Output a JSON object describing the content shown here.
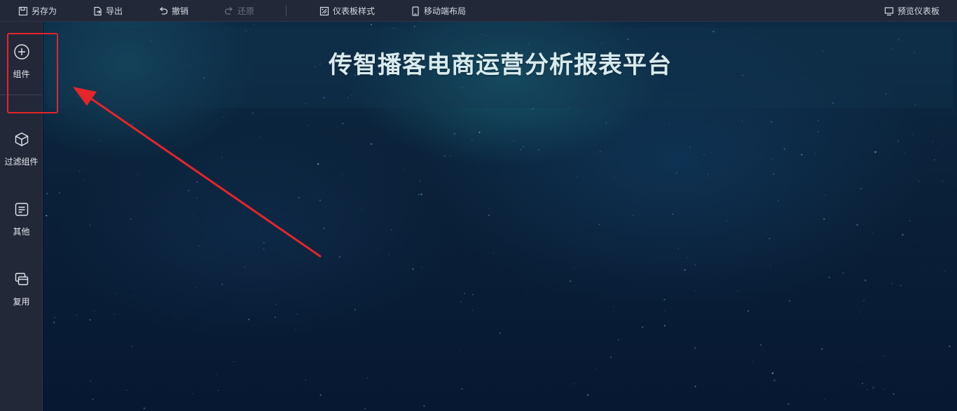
{
  "toolbar": {
    "save_as": "另存为",
    "export": "导出",
    "undo": "撤销",
    "redo": "还原",
    "dashboard_style": "仪表板样式",
    "mobile_layout": "移动端布局",
    "preview": "预览仪表板"
  },
  "sidebar": {
    "items": [
      {
        "label": "组件",
        "icon": "plus-circle-icon"
      },
      {
        "label": "过滤组件",
        "icon": "cube-icon"
      },
      {
        "label": "其他",
        "icon": "document-icon"
      },
      {
        "label": "复用",
        "icon": "copy-icon"
      }
    ]
  },
  "canvas": {
    "title": "传智播客电商运营分析报表平台"
  },
  "annotation": {
    "color": "#e5252a"
  }
}
